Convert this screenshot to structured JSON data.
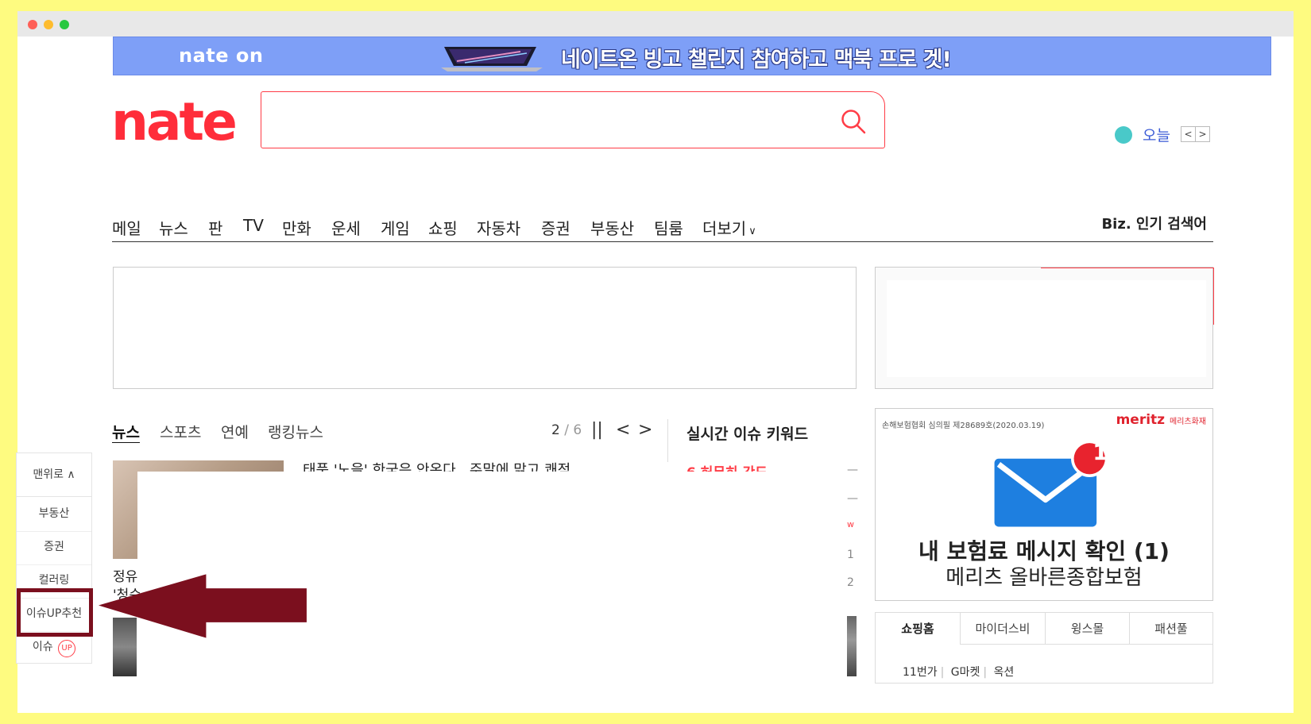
{
  "colors": {
    "brand": "#ff2d3a",
    "banner": "#7e9ff7",
    "highlight": "#7b0f1e",
    "page_bg": "#fefb80"
  },
  "banner": {
    "logo": "nate on",
    "text": "네이트온 빙고 챌린지 참여하고 맥북 프로 겟!",
    "icon": "laptop-icon"
  },
  "header": {
    "logo": "nate",
    "search": {
      "placeholder": "",
      "value": "",
      "icon": "search-icon"
    },
    "weather": {
      "label": "오늘",
      "prev": "<",
      "next": ">"
    }
  },
  "gnb": {
    "items": [
      "메일",
      "뉴스",
      "판",
      "TV",
      "만화",
      "운세",
      "게임",
      "쇼핑",
      "자동차",
      "증권",
      "부동산",
      "팀룸",
      "더보기"
    ],
    "more_icon": "chevron-down-icon",
    "biz": "Biz. 인기 검색어"
  },
  "news": {
    "tabs": [
      "뉴스",
      "스포츠",
      "연예",
      "랭킹뉴스"
    ],
    "pager": {
      "current": "2",
      "total": "6"
    },
    "controls": {
      "pause": "||",
      "prev": "<",
      "next": ">"
    },
    "headline": "태풍 '노을' 한국은 안온다...주말에 맑고 쾌적",
    "snippet_1": "정유",
    "snippet_2": "'청순"
  },
  "realtime": {
    "title": "실시간 이슈 키워드",
    "first_keyword": "6  허무히 간도",
    "side_marks": [
      "—",
      "—",
      "w",
      "1",
      "2"
    ]
  },
  "quickmenu": {
    "top": "맨위로",
    "top_icon": "chevron-up-icon",
    "items": [
      "부동산",
      "증권",
      "컬러링",
      "이슈UP추천",
      "이슈"
    ],
    "up_badge": "UP"
  },
  "meritz": {
    "legal": "손해보험협회 심의필 제28689호(2020.03.19)",
    "brand": "meritz",
    "brand_sub": "메리츠화재",
    "badge": "1",
    "title": "내 보험료 메시지 확인 (1)",
    "subtitle": "메리츠 올바른종합보험"
  },
  "shopping": {
    "tabs": [
      "쇼핑홈",
      "마이더스비",
      "윙스몰",
      "패션풀"
    ],
    "links": [
      "11번가",
      "G마켓",
      "옥션"
    ]
  }
}
